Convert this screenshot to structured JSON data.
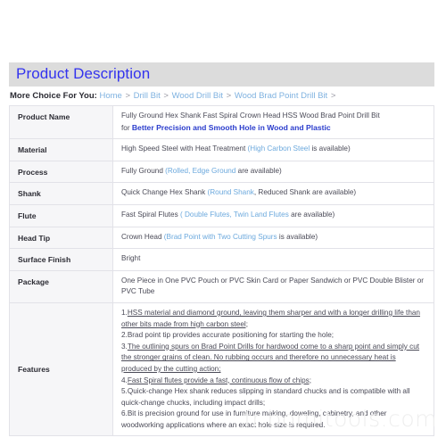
{
  "section": {
    "title": "Product Description"
  },
  "breadcrumb": {
    "label": "More Choice For You:",
    "separator": ">",
    "items": [
      {
        "label": "Home"
      },
      {
        "label": "Drill Bit"
      },
      {
        "label": "Wood Drill Bit"
      },
      {
        "label": "Wood Brad Point Drill Bit"
      }
    ],
    "trailing_separator": ">"
  },
  "spec_table": {
    "rows": [
      {
        "key": "Product Name",
        "value_line1": "Fully Ground Hex Shank Fast Spiral Crown Head HSS Wood Brad Point Drill Bit",
        "value_line2_prefix": "for ",
        "value_line2_strong": "Better Precision and Smooth Hole in Wood and Plastic"
      },
      {
        "key": "Material",
        "value_main": "High Speed Steel with Heat Treatment",
        "value_paren_open": "(",
        "value_link": "High Carbon Steel",
        "value_paren_tail": " is available)"
      },
      {
        "key": "Process",
        "value_main": "Fully Ground",
        "value_paren_open": "(",
        "value_link": "Rolled, Edge Ground",
        "value_paren_tail": " are available)"
      },
      {
        "key": "Shank",
        "value_main": "Quick Change Hex Shank",
        "value_paren_open": "(",
        "value_link": "Round Shank",
        "value_paren_tail": ", Reduced Shank are  available)"
      },
      {
        "key": "Flute",
        "value_main": "Fast Spiral Flutes",
        "value_paren_open": "( ",
        "value_link": "Double Flutes, Twin Land Flutes",
        "value_paren_tail": " are available)"
      },
      {
        "key": "Head Tip",
        "value_main": "Crown Head",
        "value_paren_open": "(",
        "value_link": "Brad Point with Two Cutting Spurs",
        "value_paren_tail": " is available)"
      },
      {
        "key": "Surface Finish",
        "value_main": "Bright",
        "value_paren_open": "",
        "value_link": "",
        "value_paren_tail": ""
      },
      {
        "key": "Package",
        "value_main": "One Piece in One PVC Pouch or PVC Skin Card  or Paper Sandwich  or PVC Double Blister or PVC Tube",
        "value_paren_open": "",
        "value_link": "",
        "value_paren_tail": ""
      }
    ],
    "features": {
      "key": "Features",
      "items": [
        {
          "number": "1.",
          "text": "HSS material and diamond ground, leaving them sharper and with a longer drilling life than other bits made from high carbon steel;",
          "underlined": true
        },
        {
          "number": "2.",
          "text": "Brad point tip provides accurate positioning for starting the hole;",
          "underlined": false
        },
        {
          "number": "3.",
          "text": "The outlining spurs on Brad Point Drills for hardwood come to a sharp point and simply cut the stronger grains of clean. No rubbing occurs and therefore no unnecessary heat is produced by the cutting action;",
          "underlined": true
        },
        {
          "number": "4.",
          "text": "Fast Spiral flutes provide a fast, continuous flow of chips;",
          "underlined": true
        },
        {
          "number": "5.",
          "text": "Quick-change Hex shank reduces slipping in standard chucks and is compatible with all quick-change chucks, including impact drills;",
          "underlined": false
        },
        {
          "number": "6.",
          "text": "Bit is precision ground for use in furniture making, doweling, cabinetry, and other woodworking applications where an exact hole size is required.",
          "underlined": false
        }
      ]
    }
  },
  "watermark": {
    "text": "fr.bomitools.com"
  },
  "colors": {
    "band_background": "#dcdcdc",
    "section_title": "#3333ee",
    "link_blue": "#6ca9dd",
    "strong_blue": "#2a3ccc",
    "body_text": "#4a4a57",
    "key_text": "#2b2b33",
    "table_border": "#e2e2e8",
    "key_cell_background": "#f6f6f8",
    "watermark": "#eeeeee"
  }
}
